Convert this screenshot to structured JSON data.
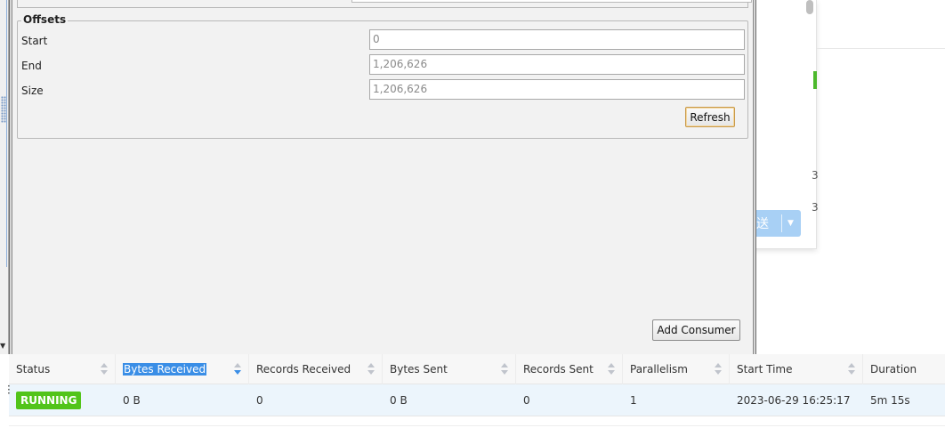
{
  "background": {
    "send_button_label": "送",
    "numbers": [
      "3",
      "3"
    ],
    "colors": {
      "accent_green": "#4cb82c",
      "send_blue": "#a8d0f5"
    }
  },
  "dialog": {
    "group_title": "Offsets",
    "rows": [
      {
        "label": "Start",
        "value": "0"
      },
      {
        "label": "End",
        "value": "1,206,626"
      },
      {
        "label": "Size",
        "value": "1,206,626"
      }
    ],
    "refresh_label": "Refresh",
    "add_consumer_label": "Add Consumer"
  },
  "table": {
    "columns": [
      {
        "label": "Status",
        "sort": "none"
      },
      {
        "label": "Bytes Received",
        "sort": "desc",
        "selected": true
      },
      {
        "label": "Records Received",
        "sort": "none"
      },
      {
        "label": "Bytes Sent",
        "sort": "none"
      },
      {
        "label": "Records Sent",
        "sort": "none"
      },
      {
        "label": "Parallelism",
        "sort": "none"
      },
      {
        "label": "Start Time",
        "sort": "none"
      },
      {
        "label": "Duration",
        "sort": "none"
      }
    ],
    "rows": [
      {
        "status": "RUNNING",
        "bytes_received": "0 B",
        "records_received": "0",
        "bytes_sent": "0 B",
        "records_sent": "0",
        "parallelism": "1",
        "start_time": "2023-06-29 16:25:17",
        "duration": "5m 15s"
      }
    ],
    "colors": {
      "status_running": "#52c41a",
      "sort_active": "#3a8ee6",
      "row_highlight": "#ecf5fc"
    }
  }
}
